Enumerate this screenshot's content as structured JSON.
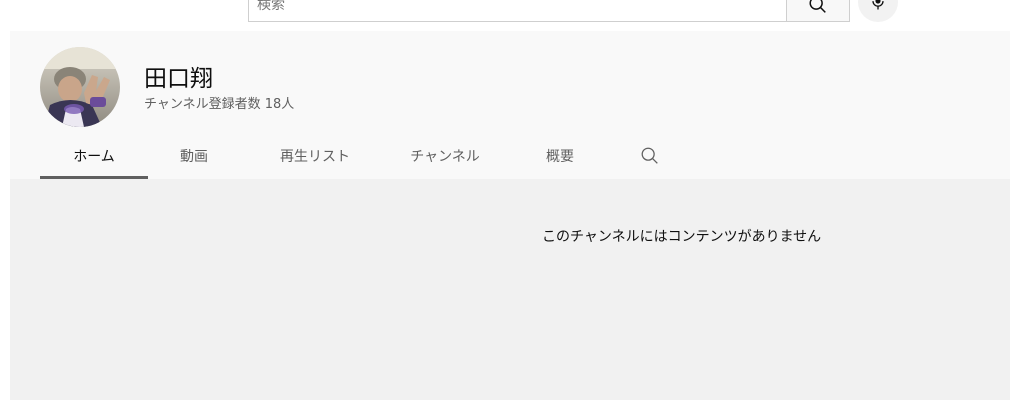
{
  "masthead": {
    "search_placeholder": "検索",
    "search_icon": "search-icon",
    "mic_icon": "microphone-icon"
  },
  "channel": {
    "name": "田口翔",
    "subscribers": "チャンネル登録者数 18人",
    "avatar": "avatar-photo"
  },
  "tabs": [
    {
      "label": "ホーム",
      "active": true
    },
    {
      "label": "動画",
      "active": false
    },
    {
      "label": "再生リスト",
      "active": false
    },
    {
      "label": "チャンネル",
      "active": false
    },
    {
      "label": "概要",
      "active": false
    }
  ],
  "tab_search_icon": "search-icon",
  "content": {
    "empty_message": "このチャンネルにはコンテンツがありません"
  }
}
